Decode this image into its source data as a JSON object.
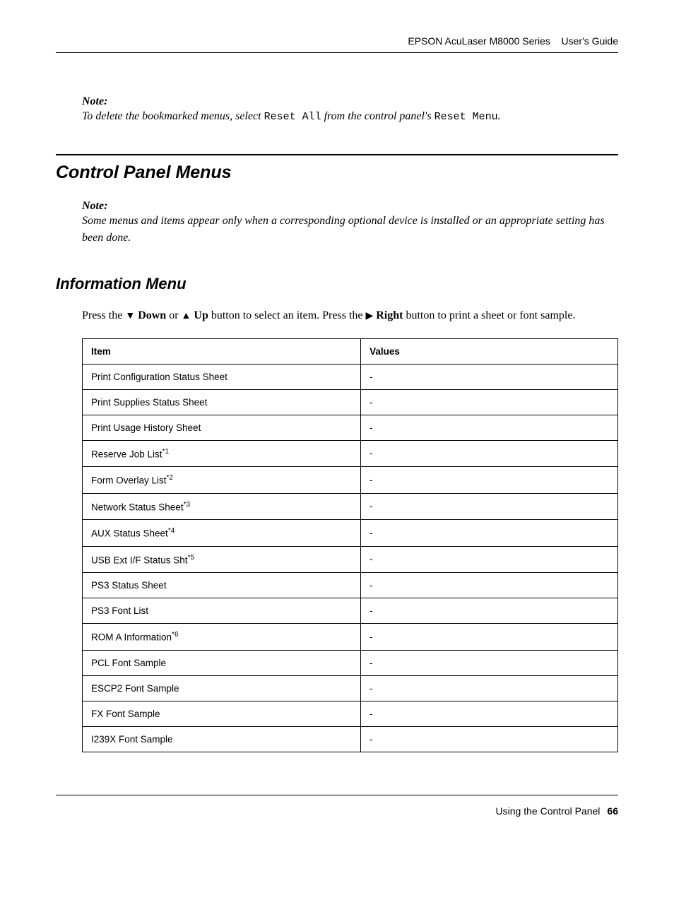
{
  "header": {
    "product": "EPSON AcuLaser M8000 Series",
    "doc_type": "User's Guide"
  },
  "note1": {
    "label": "Note:",
    "pre": "To delete the bookmarked menus, select ",
    "mono1": "Reset All",
    "mid": " from the control panel's ",
    "mono2": "Reset Menu",
    "post": "."
  },
  "section1": {
    "title": "Control Panel Menus"
  },
  "note2": {
    "label": "Note:",
    "text": "Some menus and items appear only when a corresponding optional device is installed or an appropriate setting has been done."
  },
  "section2": {
    "title": "Information Menu"
  },
  "instruction": {
    "t1": "Press the ",
    "down": "Down",
    "t2": " or ",
    "up": "Up",
    "t3": " button to select an item. Press the ",
    "right": "Right",
    "t4": " button to print a sheet or font sample."
  },
  "table": {
    "head_item": "Item",
    "head_values": "Values",
    "rows": [
      {
        "item": "Print Configuration Status Sheet",
        "sup": "",
        "value": "-"
      },
      {
        "item": "Print Supplies Status Sheet",
        "sup": "",
        "value": "-"
      },
      {
        "item": "Print Usage History Sheet",
        "sup": "",
        "value": "-"
      },
      {
        "item": "Reserve Job List",
        "sup": "*1",
        "value": "-"
      },
      {
        "item": "Form Overlay List",
        "sup": "*2",
        "value": "-"
      },
      {
        "item": "Network Status Sheet",
        "sup": "*3",
        "value": "-"
      },
      {
        "item": "AUX Status Sheet",
        "sup": "*4",
        "value": "-"
      },
      {
        "item": "USB Ext I/F Status Sht",
        "sup": "*5",
        "value": "-"
      },
      {
        "item": "PS3 Status Sheet",
        "sup": "",
        "value": "-"
      },
      {
        "item": "PS3 Font List",
        "sup": "",
        "value": "-"
      },
      {
        "item": "ROM A Information",
        "sup": "*6",
        "value": "-"
      },
      {
        "item": "PCL Font Sample",
        "sup": "",
        "value": "-"
      },
      {
        "item": "ESCP2 Font Sample",
        "sup": "",
        "value": "-"
      },
      {
        "item": "FX Font Sample",
        "sup": "",
        "value": "-"
      },
      {
        "item": "I239X Font Sample",
        "sup": "",
        "value": "-"
      }
    ]
  },
  "footer": {
    "text": "Using the Control Panel",
    "page": "66"
  }
}
